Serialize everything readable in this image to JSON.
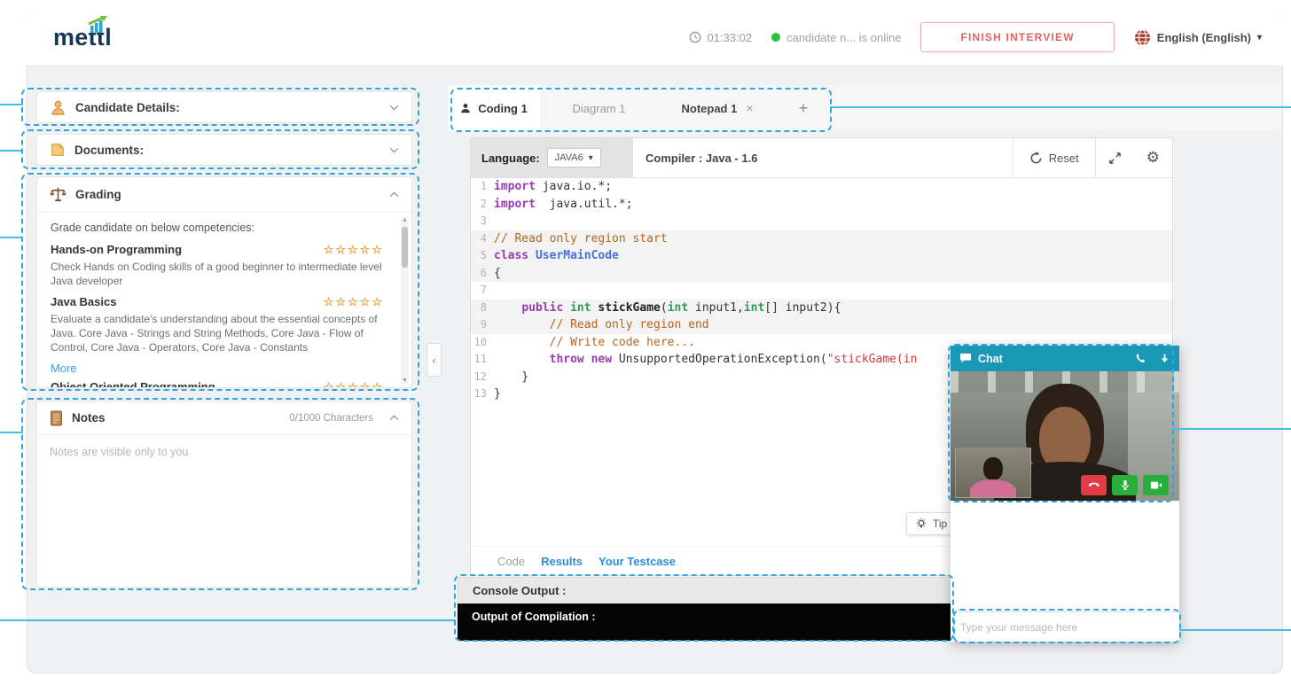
{
  "topbar": {
    "logo": "mettl",
    "timer": "01:33:02",
    "presence": "candidate n... is online",
    "finish_button": "FINISH INTERVIEW",
    "language": "English (English)"
  },
  "sidebar": {
    "candidate_details_title": "Candidate Details:",
    "documents_title": "Documents:",
    "grading": {
      "title": "Grading",
      "instruction": "Grade candidate on below competencies:",
      "competencies": [
        {
          "name": "Hands-on Programming",
          "stars": 5,
          "description": "Check Hands on Coding skills of a good beginner to intermediate level Java developer"
        },
        {
          "name": "Java Basics",
          "stars": 5,
          "description": "Evaluate a candidate's understanding about the essential concepts of Java. Core Java - Strings and String Methods, Core Java - Flow of Control, Core Java - Operators, Core Java - Constants"
        },
        {
          "name": "Object Oriented Programming",
          "stars": 5,
          "description": "",
          "clipped": true
        }
      ],
      "more_link": "More"
    },
    "notes": {
      "title": "Notes",
      "char_counter": "0/1000 Characters",
      "placeholder": "Notes are visible only to you"
    }
  },
  "main": {
    "tabs": [
      {
        "label": "Coding 1",
        "active": true,
        "icon": "user"
      },
      {
        "label": "Diagram 1",
        "active": false
      },
      {
        "label": "Notepad 1",
        "active": false,
        "closable": true
      }
    ],
    "editor": {
      "language_label": "Language:",
      "language_value": "JAVA6",
      "compiler_text": "Compiler : Java - 1.6",
      "reset_label": "Reset",
      "tip_label": "Tip",
      "bottom_tabs": [
        {
          "label": "Code",
          "active": true
        },
        {
          "label": "Results",
          "active": false
        },
        {
          "label": "Your Testcase",
          "active": false
        }
      ],
      "code_lines": [
        {
          "n": 1,
          "ro": false,
          "seg": [
            {
              "t": "import",
              "c": "kw"
            },
            {
              "t": " java.io.*;",
              "c": "pl"
            }
          ]
        },
        {
          "n": 2,
          "ro": false,
          "seg": [
            {
              "t": "import",
              "c": "kw"
            },
            {
              "t": "  java.util.*;",
              "c": "pl"
            }
          ]
        },
        {
          "n": 3,
          "ro": false,
          "seg": []
        },
        {
          "n": 4,
          "ro": true,
          "seg": [
            {
              "t": "// Read only region start",
              "c": "cm"
            }
          ]
        },
        {
          "n": 5,
          "ro": true,
          "seg": [
            {
              "t": "class",
              "c": "kw"
            },
            {
              "t": " ",
              "c": "pl"
            },
            {
              "t": "UserMainCode",
              "c": "cls"
            }
          ]
        },
        {
          "n": 6,
          "ro": true,
          "seg": [
            {
              "t": "{",
              "c": "pl"
            }
          ]
        },
        {
          "n": 7,
          "ro": false,
          "seg": []
        },
        {
          "n": 8,
          "ro": true,
          "seg": [
            {
              "t": "    ",
              "c": "pl"
            },
            {
              "t": "public",
              "c": "kw"
            },
            {
              "t": " ",
              "c": "pl"
            },
            {
              "t": "int",
              "c": "ty"
            },
            {
              "t": " ",
              "c": "pl"
            },
            {
              "t": "stickGame",
              "c": "fn"
            },
            {
              "t": "(",
              "c": "pl"
            },
            {
              "t": "int",
              "c": "ty"
            },
            {
              "t": " input1,",
              "c": "pl"
            },
            {
              "t": "int",
              "c": "ty"
            },
            {
              "t": "[] input2){",
              "c": "pl"
            }
          ]
        },
        {
          "n": 9,
          "ro": true,
          "seg": [
            {
              "t": "        // Read only region end",
              "c": "cm"
            }
          ]
        },
        {
          "n": 10,
          "ro": false,
          "seg": [
            {
              "t": "        // Write code here...",
              "c": "cm"
            }
          ]
        },
        {
          "n": 11,
          "ro": false,
          "seg": [
            {
              "t": "        ",
              "c": "pl"
            },
            {
              "t": "throw",
              "c": "kw"
            },
            {
              "t": " ",
              "c": "pl"
            },
            {
              "t": "new",
              "c": "kw"
            },
            {
              "t": " UnsupportedOperationException(",
              "c": "pl"
            },
            {
              "t": "\"stickGame(in",
              "c": "str"
            }
          ]
        },
        {
          "n": 12,
          "ro": false,
          "seg": [
            {
              "t": "    }",
              "c": "pl"
            }
          ]
        },
        {
          "n": 13,
          "ro": false,
          "seg": [
            {
              "t": "}",
              "c": "pl"
            }
          ]
        }
      ]
    },
    "console": {
      "header": "Console Output :",
      "compilation_label": "Output of Compilation :"
    }
  },
  "chat": {
    "title": "Chat",
    "input_placeholder": "Type your message here"
  },
  "colors": {
    "accent_teal": "#1898b5",
    "annotation_blue": "#2fa5e0",
    "finish_red": "#e2625f",
    "star_orange": "#e9a33c",
    "online_green": "#27c340",
    "console_black": "#050505"
  }
}
